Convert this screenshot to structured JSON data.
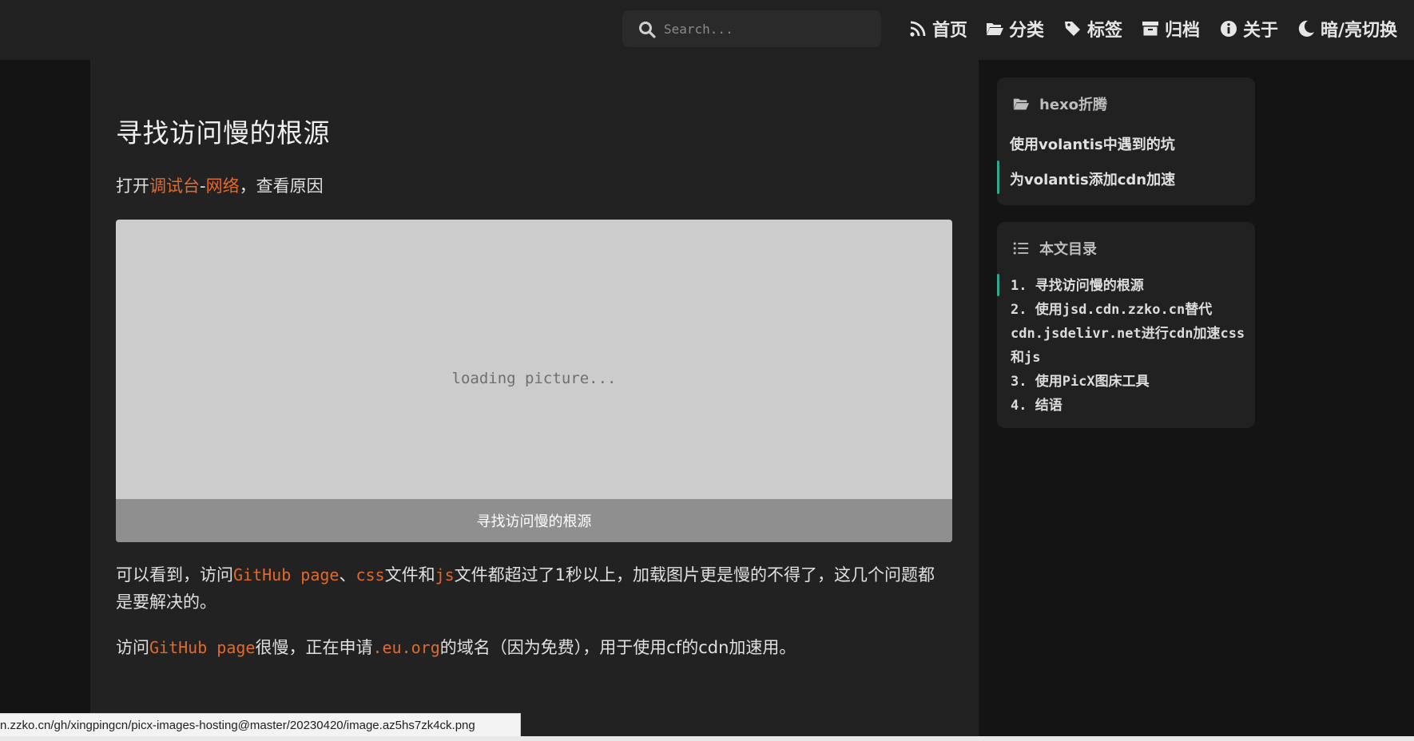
{
  "search": {
    "placeholder": "Search..."
  },
  "nav": [
    {
      "label": "首页",
      "icon": "rss-icon"
    },
    {
      "label": "分类",
      "icon": "folder-open-icon"
    },
    {
      "label": "标签",
      "icon": "tags-icon"
    },
    {
      "label": "归档",
      "icon": "archive-icon"
    },
    {
      "label": "关于",
      "icon": "info-circle-icon"
    },
    {
      "label": "暗/亮切换",
      "icon": "moon-icon"
    }
  ],
  "article": {
    "title": "寻找访问慢的根源",
    "p1": {
      "pre": "打开",
      "link1": "调试台",
      "sep": "-",
      "link2": "网络",
      "post": "，查看原因"
    },
    "figure": {
      "loading": "loading picture...",
      "caption": "寻找访问慢的根源"
    },
    "p2": {
      "t1": "可以看到，访问",
      "c1": "GitHub page",
      "t2": "、",
      "c2": "css",
      "t3": "文件和",
      "c3": "js",
      "t4": "文件都超过了1秒以上，加载图片更是慢的不得了，这几个问题都",
      "t5": "是要解决的。"
    },
    "p3": {
      "t1": "访问",
      "c1": "GitHub page",
      "t2": "很慢，正在申请",
      "c2": ".eu.org",
      "t3": "的域名（因为免费），用于使用cf的cdn加速用。"
    }
  },
  "sidebar": {
    "category": {
      "heading": "hexo折腾",
      "links": [
        "使用volantis中遇到的坑",
        "为volantis添加cdn加速"
      ]
    },
    "toc": {
      "heading": "本文目录",
      "items": [
        "1. 寻找访问慢的根源",
        "2. 使用jsd.cdn.zzko.cn替代cdn.jsdelivr.net进行cdn加速css和js",
        "3. 使用PicX图床工具",
        "4. 结语"
      ]
    }
  },
  "status_url": "n.zzko.cn/gh/xingpingcn/picx-images-hosting@master/20230420/image.az5hs7zk4ck.png",
  "colors": {
    "accent": "#e2692c",
    "active": "#2fa88c"
  }
}
